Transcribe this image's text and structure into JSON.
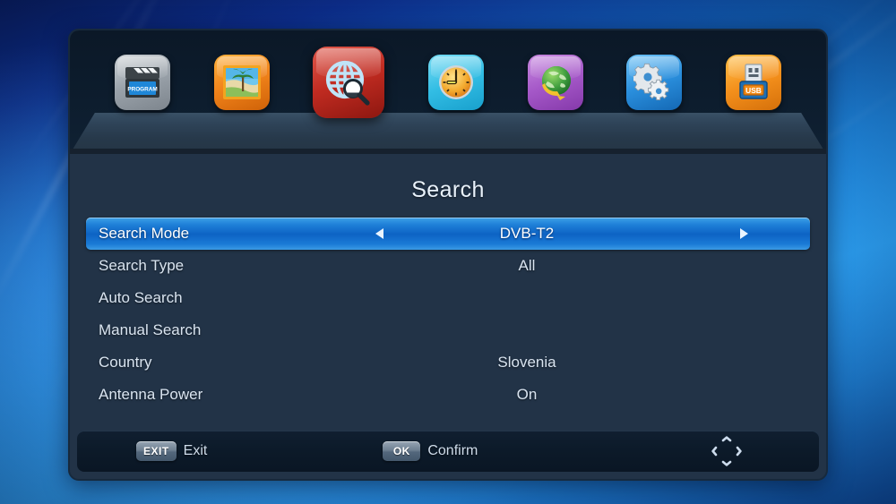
{
  "window": {
    "title": "Search"
  },
  "iconbar": {
    "items": [
      {
        "name": "program-icon",
        "label": "Program",
        "badge": "PROGRAM",
        "selected": false
      },
      {
        "name": "picture-icon",
        "label": "Picture",
        "badge": "",
        "selected": false
      },
      {
        "name": "search-icon",
        "label": "Search",
        "badge": "",
        "selected": true
      },
      {
        "name": "time-icon",
        "label": "Time",
        "badge": "",
        "selected": false
      },
      {
        "name": "system-icon",
        "label": "System",
        "badge": "",
        "selected": false
      },
      {
        "name": "setup-icon",
        "label": "Setup",
        "badge": "",
        "selected": false
      },
      {
        "name": "usb-icon",
        "label": "USB",
        "badge": "USB",
        "selected": false
      }
    ]
  },
  "menu": {
    "rows": [
      {
        "label": "Search Mode",
        "value": "DVB-T2",
        "selected": true,
        "adjustable": true
      },
      {
        "label": "Search Type",
        "value": "All",
        "selected": false,
        "adjustable": false
      },
      {
        "label": "Auto Search",
        "value": "",
        "selected": false,
        "adjustable": false
      },
      {
        "label": "Manual Search",
        "value": "",
        "selected": false,
        "adjustable": false
      },
      {
        "label": "Country",
        "value": "Slovenia",
        "selected": false,
        "adjustable": false
      },
      {
        "label": "Antenna Power",
        "value": "On",
        "selected": false,
        "adjustable": false
      }
    ]
  },
  "footer": {
    "exit_key": "EXIT",
    "exit_label": "Exit",
    "ok_key": "OK",
    "ok_label": "Confirm",
    "navpad_icon": "four-way-arrows-icon"
  },
  "colors": {
    "accent": "#1f80d8",
    "panel_bg": "#223347",
    "iconbar_bg": "#0d1d2e",
    "footer_bg": "#0c1a29",
    "text": "#d9e4f0",
    "text_selected": "#ffffff"
  }
}
